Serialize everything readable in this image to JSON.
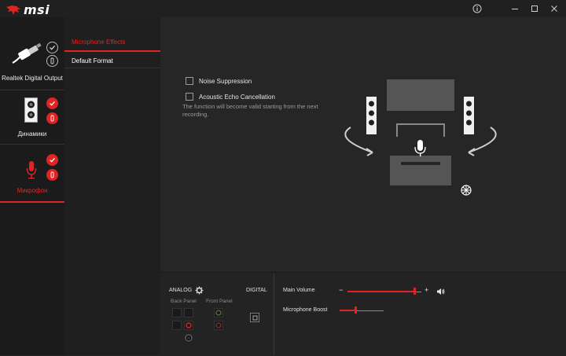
{
  "app": {
    "logo_text": "msi"
  },
  "window_controls": [
    "info-icon",
    "minimize-icon",
    "maximize-icon",
    "close-icon"
  ],
  "devices": [
    {
      "label": "Realtek Digital Output",
      "active": false,
      "icon": "optical-cable-icon"
    },
    {
      "label": "Динамики",
      "active": false,
      "icon": "speaker-icon"
    },
    {
      "label": "Микрофон",
      "active": true,
      "icon": "microphone-icon"
    }
  ],
  "subnav": {
    "items": [
      {
        "label": "Microphone Effects",
        "active": true
      },
      {
        "label": "Default Format",
        "active": false
      }
    ]
  },
  "effects": {
    "noise_suppression": {
      "label": "Noise Suppression",
      "checked": false
    },
    "echo_cancellation": {
      "label": "Acoustic Echo Cancellation",
      "checked": false
    },
    "note": "The function will become valid starting from the next recording."
  },
  "connectors": {
    "analog_label": "ANALOG",
    "digital_label": "DIGITAL",
    "back_panel_label": "Back Panel",
    "front_panel_label": "Front Panel"
  },
  "volume": {
    "main_label": "Main Volume",
    "minus": "−",
    "plus": "+",
    "main_value": 0.9,
    "boost_label": "Microphone Boost",
    "boost_value": 0.35
  },
  "colors": {
    "accent": "#e02424",
    "bg": "#262626",
    "sidebar": "#1b1b1b"
  }
}
